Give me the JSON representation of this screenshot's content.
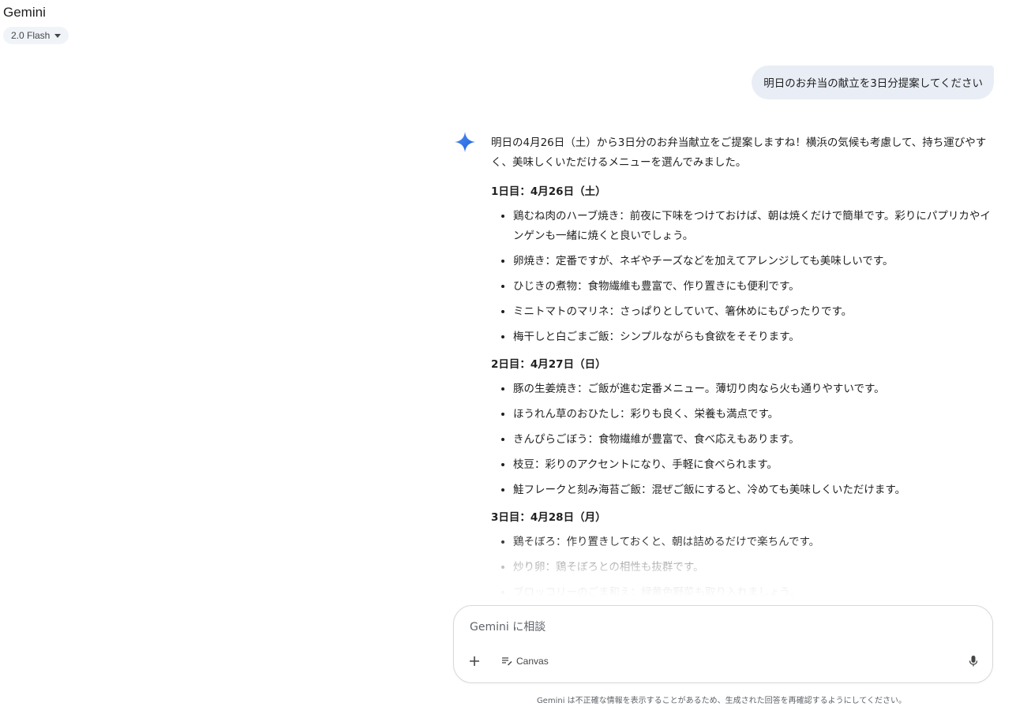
{
  "header": {
    "app_title": "Gemini",
    "model_label": "2.0 Flash"
  },
  "user_message": "明日のお弁当の献立を3日分提案してください",
  "response": {
    "intro": "明日の4月26日（土）から3日分のお弁当献立をご提案しますね！横浜の気候も考慮して、持ち運びやすく、美味しくいただけるメニューを選んでみました。",
    "days": [
      {
        "heading": "1日目：4月26日（土）",
        "items": [
          "鶏むね肉のハーブ焼き：前夜に下味をつけておけば、朝は焼くだけで簡単です。彩りにパプリカやインゲンも一緒に焼くと良いでしょう。",
          "卵焼き：定番ですが、ネギやチーズなどを加えてアレンジしても美味しいです。",
          "ひじきの煮物：食物繊維も豊富で、作り置きにも便利です。",
          "ミニトマトのマリネ：さっぱりとしていて、箸休めにもぴったりです。",
          "梅干しと白ごまご飯：シンプルながらも食欲をそそります。"
        ]
      },
      {
        "heading": "2日目：4月27日（日）",
        "items": [
          "豚の生姜焼き：ご飯が進む定番メニュー。薄切り肉なら火も通りやすいです。",
          "ほうれん草のおひたし：彩りも良く、栄養も満点です。",
          "きんぴらごぼう：食物繊維が豊富で、食べ応えもあります。",
          "枝豆：彩りのアクセントになり、手軽に食べられます。",
          "鮭フレークと刻み海苔ご飯：混ぜご飯にすると、冷めても美味しくいただけます。"
        ]
      },
      {
        "heading": "3日目：4月28日（月）",
        "items": [
          "鶏そぼろ：作り置きしておくと、朝は詰めるだけで楽ちんです。",
          "炒り卵：鶏そぼろとの相性も抜群です。",
          "ブロッコリーのごま和え：緑黄色野菜も取り入れましょう。"
        ]
      }
    ]
  },
  "composer": {
    "placeholder": "Gemini に相談",
    "canvas_label": "Canvas"
  },
  "disclaimer": "Gemini は不正確な情報を表示することがあるため、生成された回答を再確認するようにしてください。",
  "colors": {
    "accent_blue": "#4285f4",
    "user_bubble_bg": "#e9eef6",
    "pill_bg": "#f0f4f9"
  }
}
